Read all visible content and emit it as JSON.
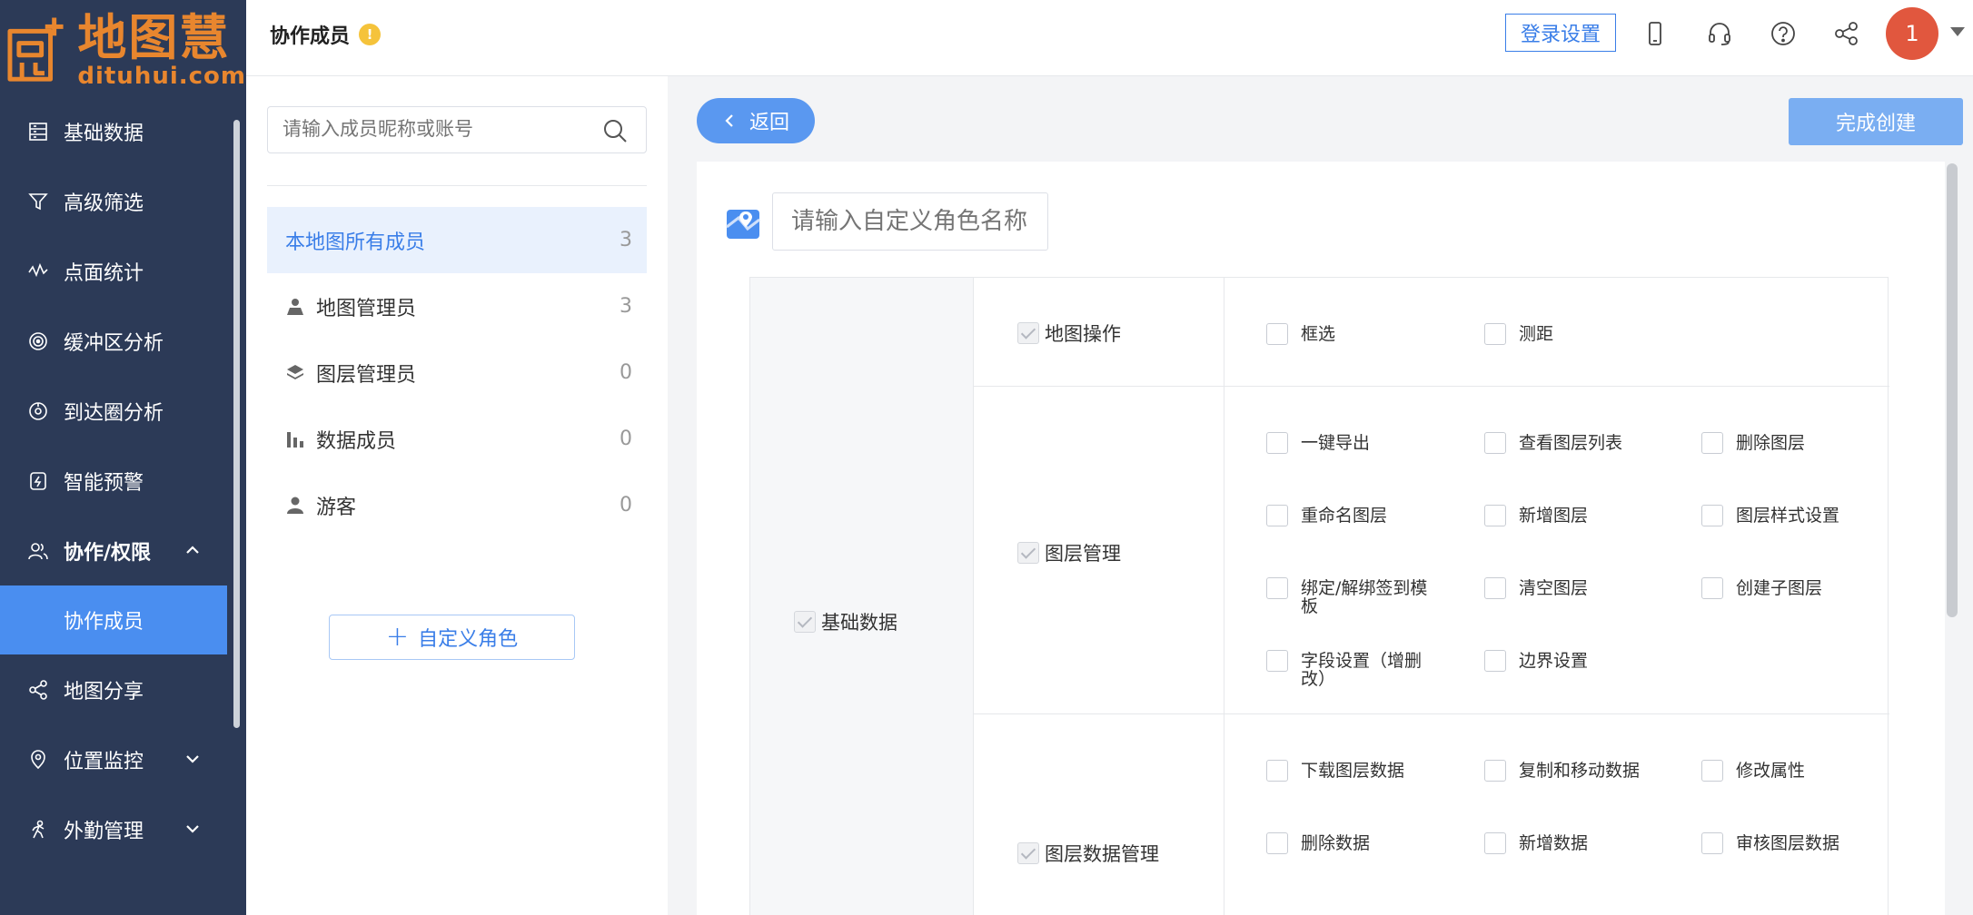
{
  "logo": {
    "cn": "地图慧",
    "en": "dituhui.com"
  },
  "sidebar": {
    "items": [
      {
        "label": "基础数据",
        "icon": "database-icon"
      },
      {
        "label": "高级筛选",
        "icon": "filter-icon"
      },
      {
        "label": "点面统计",
        "icon": "chart-line-icon"
      },
      {
        "label": "缓冲区分析",
        "icon": "buffer-icon"
      },
      {
        "label": "到达圈分析",
        "icon": "reach-icon"
      },
      {
        "label": "智能预警",
        "icon": "alert-icon"
      },
      {
        "label": "协作/权限",
        "icon": "users-icon"
      },
      {
        "label": "协作成员"
      },
      {
        "label": "地图分享",
        "icon": "share-icon"
      },
      {
        "label": "位置监控",
        "icon": "location-icon"
      },
      {
        "label": "外勤管理",
        "icon": "field-icon"
      }
    ]
  },
  "header": {
    "title": "协作成员",
    "info_icon": "!",
    "login_settings": "登录设置",
    "avatar_text": "1"
  },
  "members": {
    "search_placeholder": "请输入成员昵称或账号",
    "roles": [
      {
        "label": "本地图所有成员",
        "count": "3"
      },
      {
        "label": "地图管理员",
        "count": "3"
      },
      {
        "label": "图层管理员",
        "count": "0"
      },
      {
        "label": "数据成员",
        "count": "0"
      },
      {
        "label": "游客",
        "count": "0"
      }
    ],
    "add_role": "自定义角色"
  },
  "main": {
    "back": "返回",
    "finish": "完成创建",
    "role_name_placeholder": "请输入自定义角色名称"
  },
  "permissions": {
    "root": "基础数据",
    "groups": [
      {
        "label": "地图操作",
        "options": [
          "框选",
          "测距"
        ]
      },
      {
        "label": "图层管理",
        "options": [
          "一键导出",
          "查看图层列表",
          "删除图层",
          "重命名图层",
          "新增图层",
          "图层样式设置",
          "绑定/解绑签到模板",
          "清空图层",
          "创建子图层",
          "字段设置（增删改）",
          "边界设置"
        ]
      },
      {
        "label": "图层数据管理",
        "options": [
          "下载图层数据",
          "复制和移动数据",
          "修改属性",
          "删除数据",
          "新增数据",
          "审核图层数据"
        ]
      }
    ]
  },
  "colors": {
    "sidebar_bg": "#2c3a57",
    "accent": "#3a7ee8",
    "logo": "#e8862e",
    "avatar": "#e1573e"
  }
}
